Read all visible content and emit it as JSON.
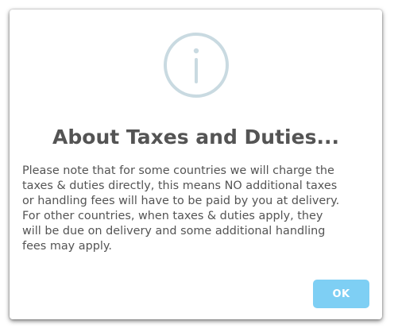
{
  "dialog": {
    "icon": "info-icon",
    "icon_color": "#c9dae1",
    "title": "About Taxes and Duties...",
    "message": "Please note that for some countries we will charge the\ntaxes & duties directly, this means NO additional taxes\nor handling fees will have to be paid by you at delivery.\nFor other countries, when taxes & duties apply, they\nwill be due on delivery and some additional handling\nfees may apply.",
    "ok_label": "OK",
    "ok_color": "#7ecff4"
  }
}
